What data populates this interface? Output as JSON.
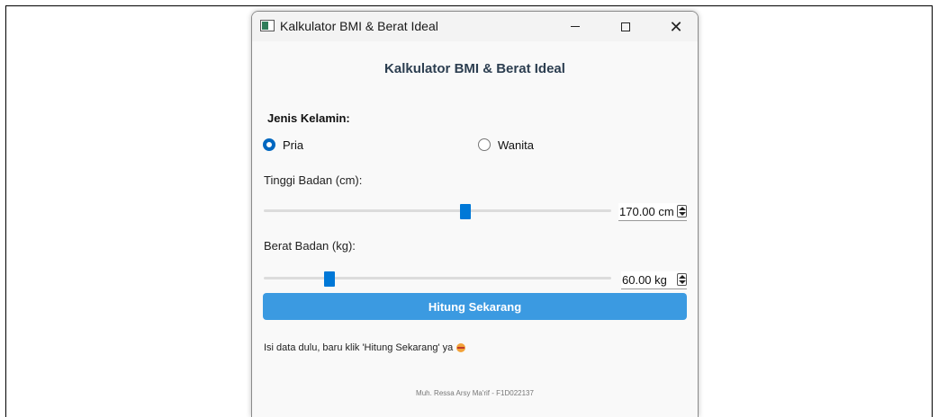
{
  "window": {
    "title": "Kalkulator BMI & Berat Ideal",
    "icon": "app-window-icon"
  },
  "heading": "Kalkulator BMI & Berat Ideal",
  "gender": {
    "label": "Jenis Kelamin:",
    "options": [
      "Pria",
      "Wanita"
    ],
    "selected": "Pria"
  },
  "height": {
    "label": "Tinggi Badan (cm):",
    "value": "170.00 cm",
    "slider_fraction": 0.58
  },
  "weight": {
    "label": "Berat Badan (kg):",
    "value": "60.00 kg",
    "slider_fraction": 0.19
  },
  "button": {
    "label": "Hitung Sekarang",
    "color": "#3b9ae1"
  },
  "hint": "Isi data dulu, baru klik 'Hitung Sekarang' ya",
  "footer": "Muh. Ressa Arsy Ma'rif - F1D022137",
  "colors": {
    "accent": "#0078d7",
    "heading": "#2c3e50"
  }
}
